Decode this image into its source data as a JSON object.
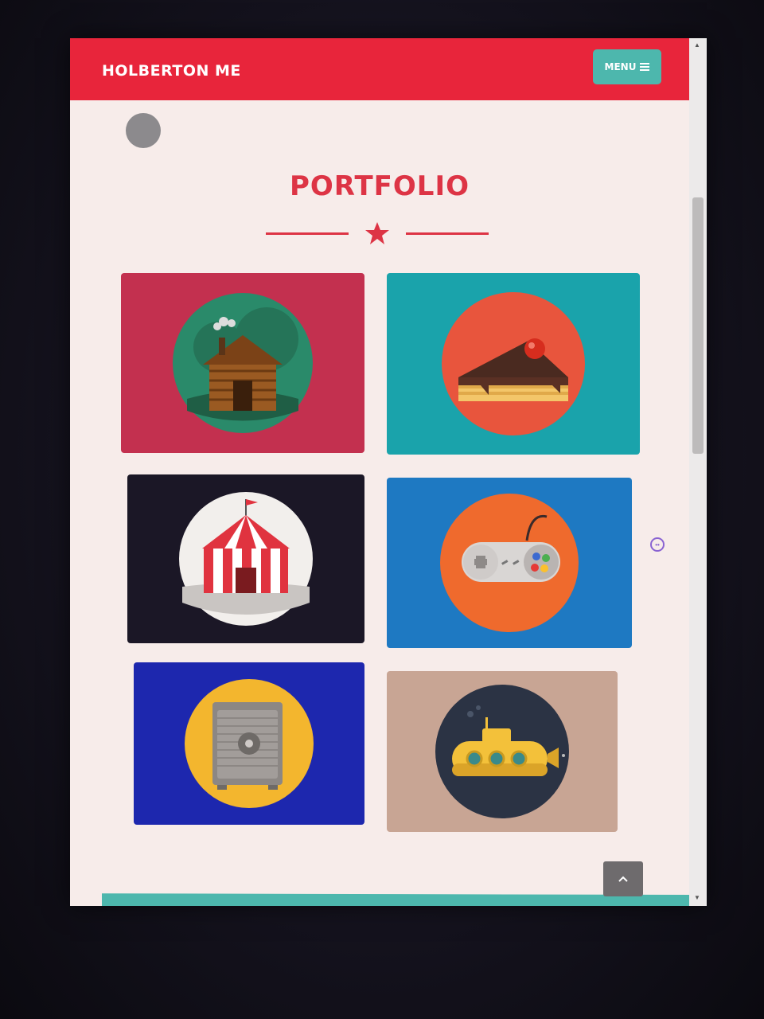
{
  "navbar": {
    "brand": "HOLBERTON ME",
    "menu_label": "MENU",
    "menu_icon": "hamburger-icon",
    "color": "#e8253b"
  },
  "section": {
    "title": "PORTFOLIO",
    "divider_icon": "star-icon",
    "accent": "#dd3445"
  },
  "portfolio": {
    "items": [
      {
        "icon": "cabin-icon",
        "background": "#c3304f"
      },
      {
        "icon": "cake-icon",
        "background": "#1aa3ab"
      },
      {
        "icon": "circus-tent-icon",
        "background": "#1b1726"
      },
      {
        "icon": "game-controller-icon",
        "background": "#1e79c2"
      },
      {
        "icon": "safe-icon",
        "background": "#1d27ae"
      },
      {
        "icon": "submarine-icon",
        "background": "#c8a594"
      }
    ]
  },
  "back_to_top": {
    "icon": "chevron-up-icon"
  },
  "theme": {
    "teal": "#4db7ad",
    "page_background": "#f7ecea"
  }
}
